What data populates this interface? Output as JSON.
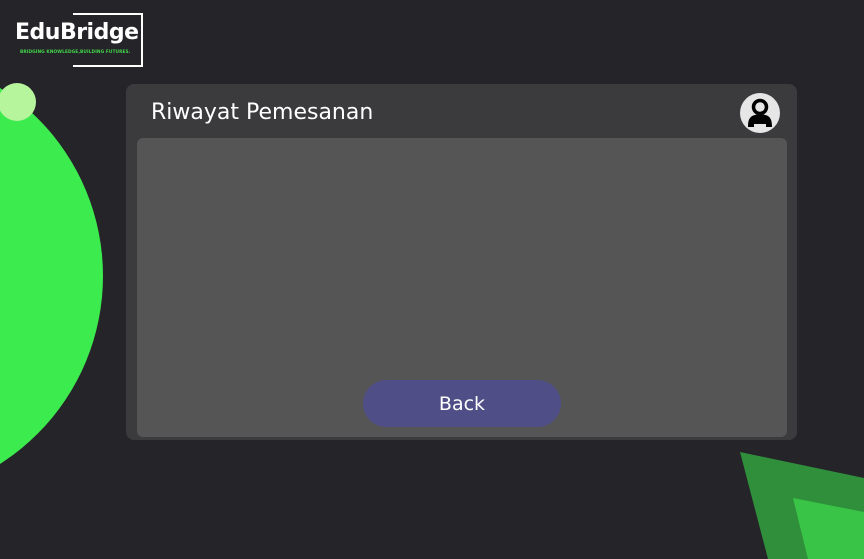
{
  "logo": {
    "title": "EduBridge",
    "tagline": "BRIDGING KNOWLEDGE,BUILDING FUTURES."
  },
  "page": {
    "title": "Riwayat Pemesanan"
  },
  "actions": {
    "back_label": "Back"
  },
  "icons": {
    "profile": "user-avatar-icon"
  },
  "colors": {
    "background": "#252429",
    "panel": "#3b3a3c",
    "content_area": "#555555",
    "accent_green": "#41ed4f",
    "button": "#4f4e86",
    "text": "#ffffff"
  }
}
